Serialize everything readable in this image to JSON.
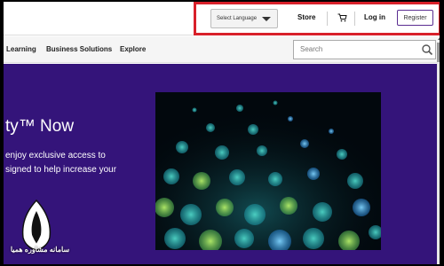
{
  "topbar": {
    "language_select": {
      "value": "Select Language"
    },
    "store_label": "Store",
    "login_label": "Log in",
    "register_label": "Register"
  },
  "nav": {
    "items": [
      {
        "label": "Learning"
      },
      {
        "label": "Business Solutions"
      },
      {
        "label": "Explore"
      }
    ],
    "search_placeholder": "Search"
  },
  "hero": {
    "title": "ty™ Now",
    "lines": [
      "enjoy exclusive access to",
      "signed to help increase your"
    ]
  },
  "watermark": {
    "text": "سامانه مشاوره همیا"
  },
  "colors": {
    "hero_bg": "#34147a",
    "highlight": "#d8202a",
    "register_border": "#5a2d91"
  }
}
